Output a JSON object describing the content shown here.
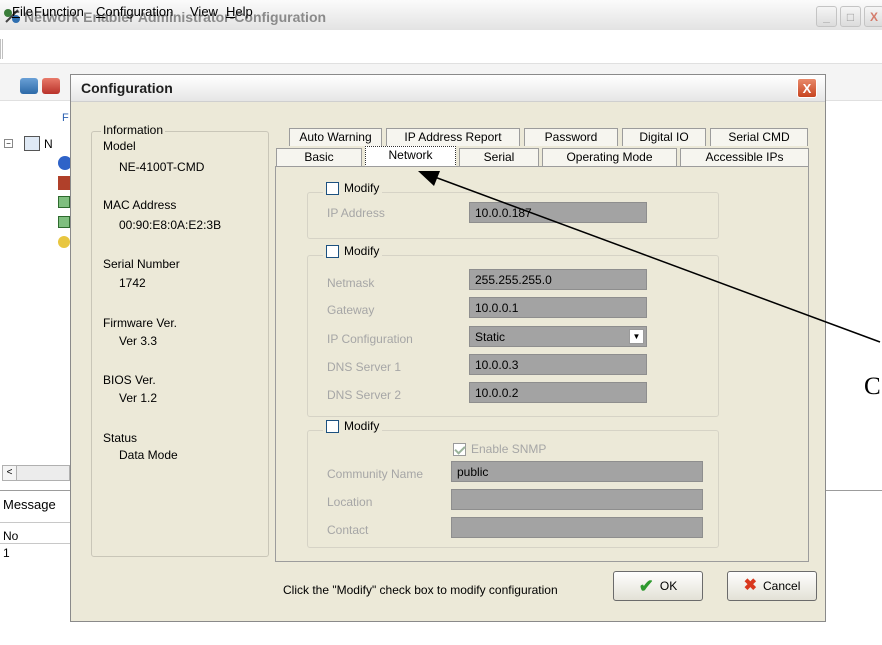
{
  "window": {
    "title": "Network Enabler Administrator-Configuration",
    "controls": [
      "_",
      "□",
      "X"
    ]
  },
  "menubar": {
    "items": [
      {
        "pre": "",
        "u": "F",
        "post": "ile"
      },
      {
        "pre": "Function",
        "u": "",
        "post": ""
      },
      {
        "pre": "",
        "u": "C",
        "post": "onfiguration"
      },
      {
        "pre": "View",
        "u": "",
        "post": ""
      },
      {
        "pre": "",
        "u": "H",
        "post": "elp"
      }
    ]
  },
  "left_pane": {
    "tree_letter": "N",
    "col_letter": "F"
  },
  "message_pane": {
    "label": "Message",
    "column_no": "No",
    "row_no": "1"
  },
  "dialog": {
    "title": "Configuration",
    "close": "X",
    "information": {
      "legend": "Information",
      "model_label": "Model",
      "model_value": "NE-4100T-CMD",
      "mac_label": "MAC Address",
      "mac_value": "00:90:E8:0A:E2:3B",
      "serial_label": "Serial Number",
      "serial_value": "1742",
      "firmware_label": "Firmware Ver.",
      "firmware_value": "Ver 3.3",
      "bios_label": "BIOS Ver.",
      "bios_value": "Ver 1.2",
      "status_label": "Status",
      "status_value": "Data Mode"
    },
    "tabs_row1": [
      "Auto Warning",
      "IP Address Report",
      "Password",
      "Digital IO",
      "Serial CMD"
    ],
    "tabs_row2": [
      "Basic",
      "Network",
      "Serial",
      "Operating Mode",
      "Accessible IPs"
    ],
    "active_tab": "Network",
    "group_ip": {
      "modify": "Modify",
      "ip_label": "IP Address",
      "ip_value": "10.0.0.187"
    },
    "group_net": {
      "modify": "Modify",
      "netmask_label": "Netmask",
      "netmask_value": "255.255.255.0",
      "gateway_label": "Gateway",
      "gateway_value": "10.0.0.1",
      "ipconf_label": "IP Configuration",
      "ipconf_value": "Static",
      "dns1_label": "DNS Server 1",
      "dns1_value": "10.0.0.3",
      "dns2_label": "DNS Server 2",
      "dns2_value": "10.0.0.2"
    },
    "group_snmp": {
      "modify": "Modify",
      "enable_label": "Enable SNMP",
      "community_label": "Community Name",
      "community_value": "public",
      "location_label": "Location",
      "location_value": "",
      "contact_label": "Contact",
      "contact_value": ""
    },
    "footer_hint": "Click the \"Modify\" check box to modify configuration",
    "ok": "OK",
    "cancel": "Cancel"
  },
  "annotation": {
    "text": "C"
  },
  "colors": {
    "dialog_bg": "#ece9d8",
    "disabled_field": "#a3a3a3",
    "ok_check": "#2f9a2f",
    "cancel_x": "#d9381e"
  }
}
